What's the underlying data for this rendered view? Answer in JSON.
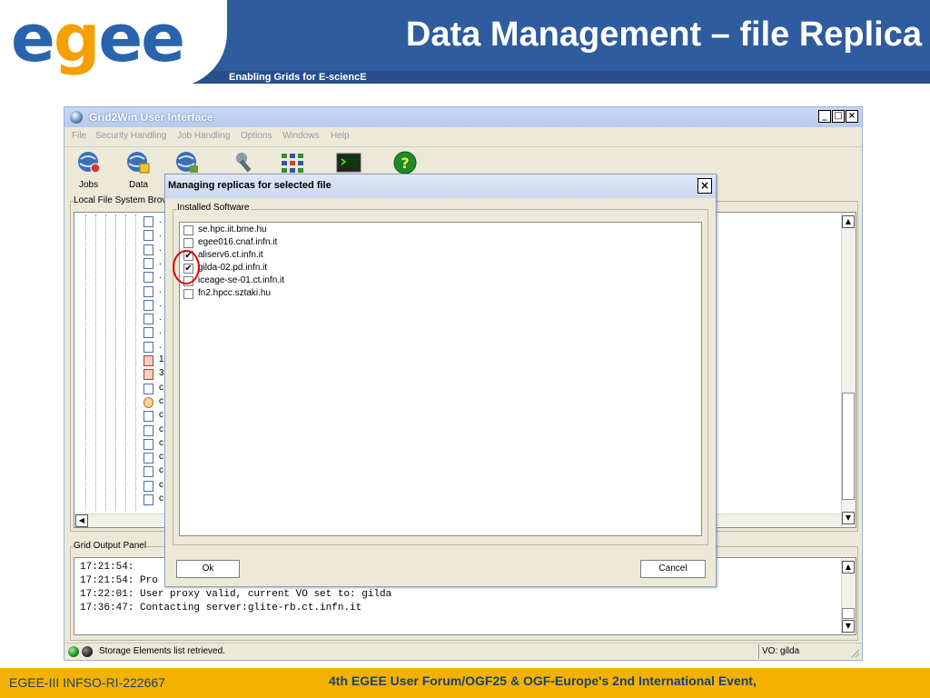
{
  "slide": {
    "logo_text_1": "e",
    "logo_text_2": "g",
    "logo_text_3": "ee",
    "title": "Data Management – file Replica",
    "subtitle": "Enabling Grids for E-sciencE",
    "footer_left": "EGEE-III INFSO-RI-222667",
    "footer_right": "4th EGEE User Forum/OGF25 & OGF-Europe's 2nd International Event,",
    "colors": {
      "header_blue": "#2e5c9e",
      "footer_gold": "#f3b200",
      "logo_orange": "#f5a000"
    }
  },
  "window": {
    "title": "Grid2Win User Interface",
    "controls": {
      "minimize": "_",
      "maximize": "□",
      "close": "×"
    },
    "menu": [
      "File",
      "Security Handling",
      "Job Handling",
      "Options",
      "Windows",
      "Help"
    ],
    "toolbar": [
      {
        "label": "Jobs",
        "icon": "globe-jobs-icon"
      },
      {
        "label": "Data",
        "icon": "globe-data-icon"
      },
      {
        "label": "",
        "icon": "globe-network-icon"
      },
      {
        "label": "",
        "icon": "tools-icon"
      },
      {
        "label": "",
        "icon": "grid-icon"
      },
      {
        "label": "",
        "icon": "terminal-icon"
      },
      {
        "label": "",
        "icon": "help-icon"
      }
    ],
    "local_panel_label": "Local File System Brov",
    "tree_chars": [
      ".",
      ".",
      ".",
      ".",
      ".",
      ".",
      ".",
      ".",
      ".",
      ".",
      "1",
      "3",
      "c",
      "c",
      "c",
      "c",
      "c",
      "c",
      "c",
      "c",
      "c"
    ],
    "output_panel_label": "Grid Output Panel",
    "output_lines": [
      "17:21:54:",
      "17:21:54: Pro",
      "17:22:01: User proxy valid, current VO set to: gilda",
      "17:36:47: Contacting server:glite-rb.ct.infn.it"
    ],
    "status_text": "Storage Elements list retrieved.",
    "status_vo": "VO: gilda"
  },
  "dialog": {
    "title": "Managing replicas for selected file",
    "close": "×",
    "group_label": "Installed Software",
    "items": [
      {
        "label": "se.hpc.iit.bme.hu",
        "checked": false
      },
      {
        "label": "egee016.cnaf.infn.it",
        "checked": false
      },
      {
        "label": "aliserv6.ct.infn.it",
        "checked": true
      },
      {
        "label": "gilda-02.pd.infn.it",
        "checked": true
      },
      {
        "label": "iceage-se-01.ct.infn.it",
        "checked": false
      },
      {
        "label": "fn2.hpcc.sztaki.hu",
        "checked": false
      }
    ],
    "check_glyph": "✔",
    "ok_label": "Ok",
    "cancel_label": "Cancel"
  }
}
